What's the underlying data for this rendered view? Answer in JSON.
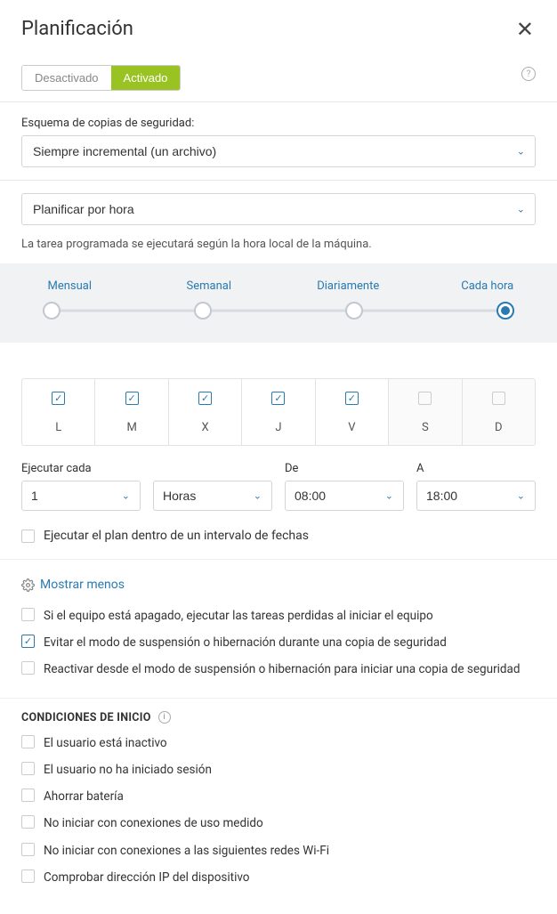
{
  "header": {
    "title": "Planificación"
  },
  "toggle": {
    "off": "Desactivado",
    "on": "Activado"
  },
  "scheme": {
    "label": "Esquema de copias de seguridad:",
    "value": "Siempre incremental (un archivo)"
  },
  "schedule_mode": {
    "value": "Planificar por hora"
  },
  "hint": "La tarea programada se ejecutará según la hora local de la máquina.",
  "frequency": {
    "options": [
      "Mensual",
      "Semanal",
      "Diariamente",
      "Cada hora"
    ],
    "selected_index": 3
  },
  "days": [
    {
      "letter": "L",
      "checked": true
    },
    {
      "letter": "M",
      "checked": true
    },
    {
      "letter": "X",
      "checked": true
    },
    {
      "letter": "J",
      "checked": true
    },
    {
      "letter": "V",
      "checked": true
    },
    {
      "letter": "S",
      "checked": false
    },
    {
      "letter": "D",
      "checked": false
    }
  ],
  "exec": {
    "every_label": "Ejecutar cada",
    "every_value": "1",
    "unit_value": "Horas",
    "from_label": "De",
    "from_value": "08:00",
    "to_label": "A",
    "to_value": "18:00"
  },
  "date_range": {
    "label": "Ejecutar el plan dentro de un intervalo de fechas",
    "checked": false
  },
  "show_less": "Mostrar menos",
  "advanced_opts": [
    {
      "label": "Si el equipo está apagado, ejecutar las tareas perdidas al iniciar el equipo",
      "checked": false
    },
    {
      "label": "Evitar el modo de suspensión o hibernación durante una copia de seguridad",
      "checked": true
    },
    {
      "label": "Reactivar desde el modo de suspensión o hibernación para iniciar una copia de seguridad",
      "checked": false
    }
  ],
  "conditions_header": "CONDICIONES DE INICIO",
  "conditions": [
    {
      "label": "El usuario está inactivo",
      "checked": false
    },
    {
      "label": "El usuario no ha iniciado sesión",
      "checked": false
    },
    {
      "label": "Ahorrar batería",
      "checked": false
    },
    {
      "label": "No iniciar con conexiones de uso medido",
      "checked": false
    },
    {
      "label": "No iniciar con conexiones a las siguientes redes Wi-Fi",
      "checked": false
    },
    {
      "label": "Comprobar dirección IP del dispositivo",
      "checked": false
    }
  ]
}
